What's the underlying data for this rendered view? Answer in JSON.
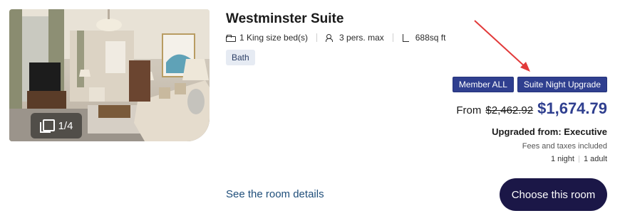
{
  "room": {
    "title": "Westminster Suite",
    "gallery": {
      "counter": "1/4"
    },
    "features": {
      "bed": "1 King size bed(s)",
      "persons": "3 pers. max",
      "area": "688sq ft"
    },
    "tag": "Bath"
  },
  "badges": {
    "member": "Member ALL",
    "upgrade": "Suite Night Upgrade"
  },
  "pricing": {
    "from_label": "From",
    "old_price": "$2,462.92",
    "new_price": "$1,674.79",
    "upgraded_from": "Upgraded from: Executive",
    "fees_note": "Fees and taxes included",
    "nights": "1 night",
    "adults": "1 adult"
  },
  "actions": {
    "details_link": "See the room details",
    "choose_button": "Choose this room"
  },
  "colors": {
    "accent": "#2f3f8f",
    "button": "#1b1747",
    "arrow": "#e23a3a"
  },
  "icons": [
    "gallery-icon",
    "bed-icon",
    "persons-icon",
    "area-icon",
    "arrow-annotation"
  ]
}
